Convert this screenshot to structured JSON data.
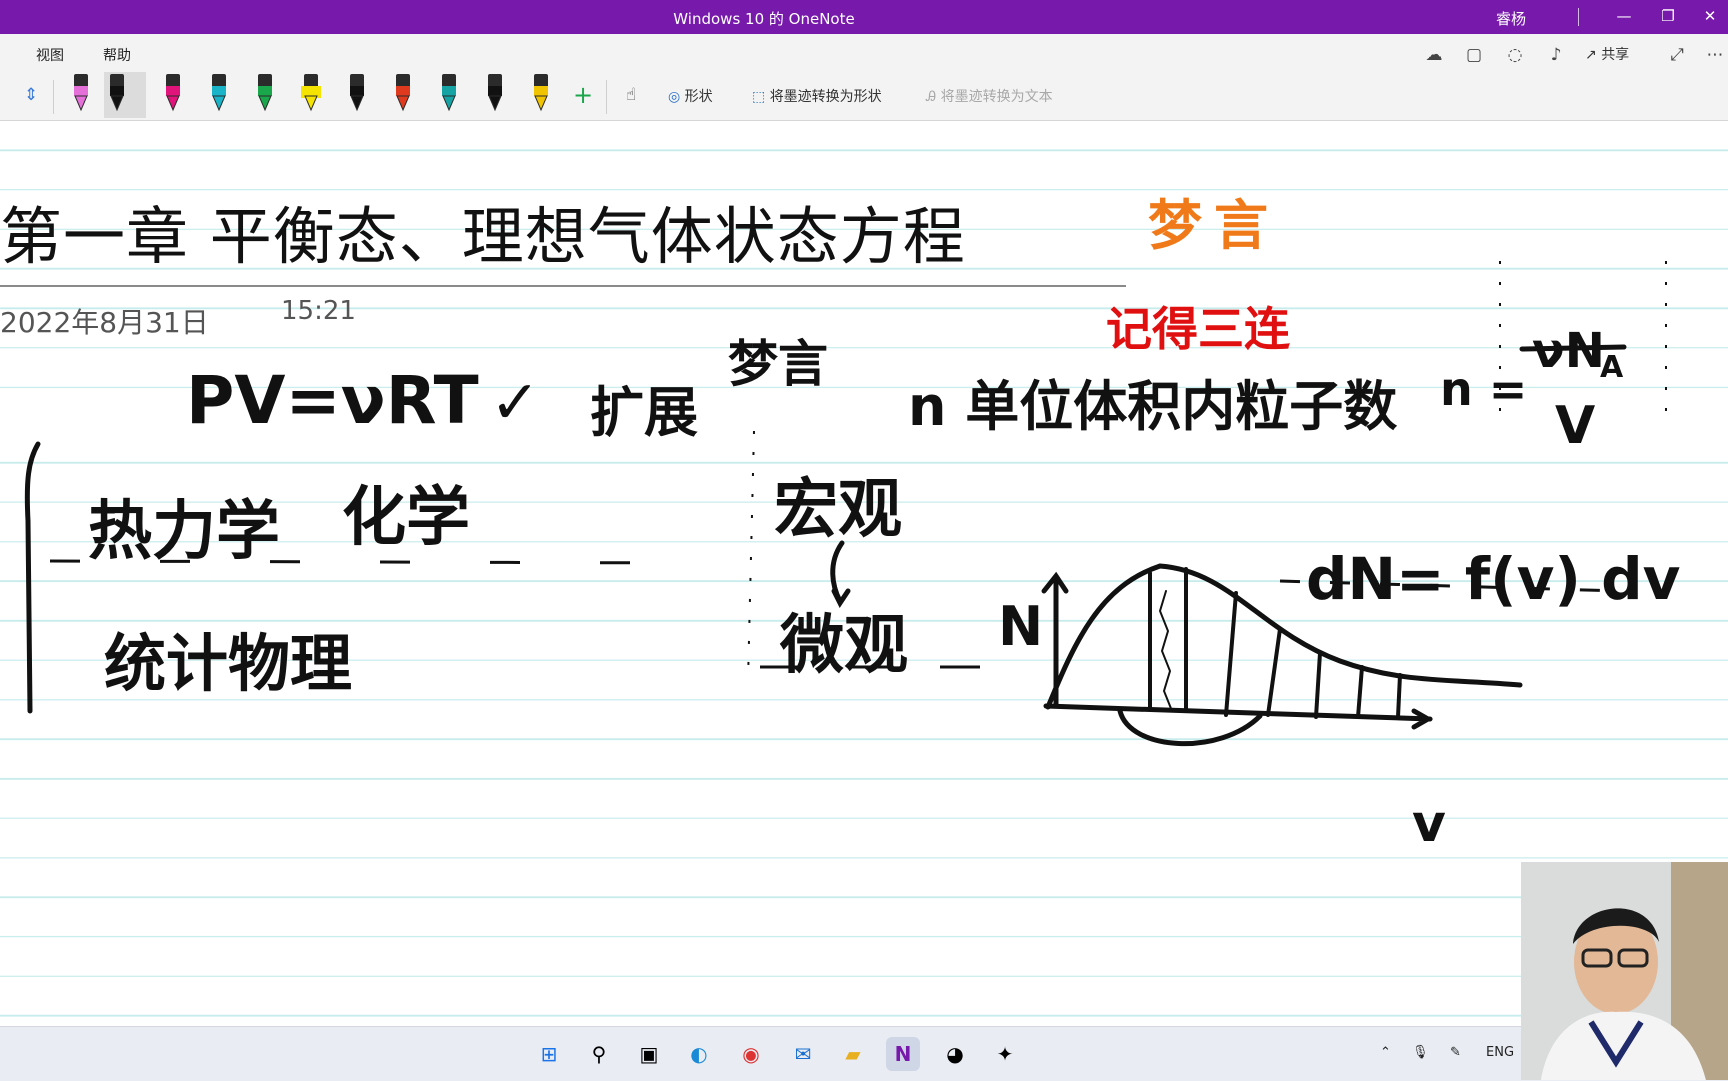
{
  "window": {
    "title": "Windows 10 的 OneNote",
    "user": "睿杨",
    "minimize": "—",
    "restore": "❐",
    "close": "✕"
  },
  "ribbon": {
    "menus": [
      "视图",
      "帮助"
    ],
    "share_label": "共享",
    "tools": {
      "shape": "形状",
      "ink_to_shape": "将墨迹转换为形状",
      "ink_to_text": "将墨迹转换为文本"
    },
    "pen_colors": [
      "#e46fd8",
      "#111111",
      "#e0147a",
      "#19b4c8",
      "#1aa64a",
      "#f5e400",
      "#111111",
      "#e03a1e",
      "#15a3a3",
      "#111111",
      "#f0c400"
    ],
    "accent": "#7719aa"
  },
  "page": {
    "title": "第一章 平衡态、理想气体状态方程",
    "date": "2022年8月31日",
    "time": "15:21",
    "watermark": "梦言"
  },
  "ink": {
    "pvnrt": "PV=νRT",
    "check": "✓",
    "expand": "扩展",
    "author": "梦言",
    "remember": "记得三连",
    "n_label": "n 单位体积内粒子数",
    "n_sym": "n =",
    "frac_num": "νN",
    "frac_sub": "A",
    "frac_den": "V",
    "thermo": "热力学",
    "chem": "化学",
    "stat_phys": "统计物理",
    "macro": "宏观",
    "micro": "微观",
    "dN_eq": "dN= f(v) dv",
    "axis_N": "N",
    "axis_v": "v"
  },
  "taskbar": {
    "lang": "ENG"
  }
}
